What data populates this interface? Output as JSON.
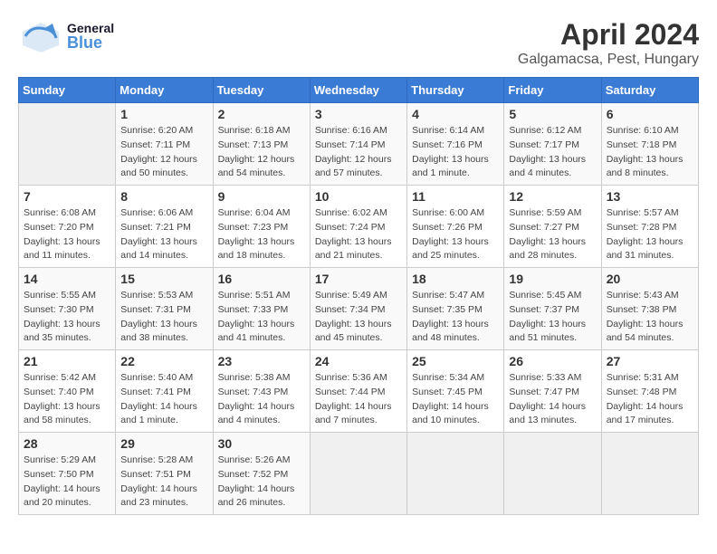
{
  "header": {
    "logo_general": "General",
    "logo_blue": "Blue",
    "title": "April 2024",
    "subtitle": "Galgamacsa, Pest, Hungary"
  },
  "calendar": {
    "days_of_week": [
      "Sunday",
      "Monday",
      "Tuesday",
      "Wednesday",
      "Thursday",
      "Friday",
      "Saturday"
    ],
    "weeks": [
      [
        {
          "day": "",
          "sunrise": "",
          "sunset": "",
          "daylight": "",
          "empty": true
        },
        {
          "day": "1",
          "sunrise": "6:20 AM",
          "sunset": "7:11 PM",
          "daylight": "12 hours and 50 minutes."
        },
        {
          "day": "2",
          "sunrise": "6:18 AM",
          "sunset": "7:13 PM",
          "daylight": "12 hours and 54 minutes."
        },
        {
          "day": "3",
          "sunrise": "6:16 AM",
          "sunset": "7:14 PM",
          "daylight": "12 hours and 57 minutes."
        },
        {
          "day": "4",
          "sunrise": "6:14 AM",
          "sunset": "7:16 PM",
          "daylight": "13 hours and 1 minute."
        },
        {
          "day": "5",
          "sunrise": "6:12 AM",
          "sunset": "7:17 PM",
          "daylight": "13 hours and 4 minutes."
        },
        {
          "day": "6",
          "sunrise": "6:10 AM",
          "sunset": "7:18 PM",
          "daylight": "13 hours and 8 minutes."
        }
      ],
      [
        {
          "day": "7",
          "sunrise": "6:08 AM",
          "sunset": "7:20 PM",
          "daylight": "13 hours and 11 minutes."
        },
        {
          "day": "8",
          "sunrise": "6:06 AM",
          "sunset": "7:21 PM",
          "daylight": "13 hours and 14 minutes."
        },
        {
          "day": "9",
          "sunrise": "6:04 AM",
          "sunset": "7:23 PM",
          "daylight": "13 hours and 18 minutes."
        },
        {
          "day": "10",
          "sunrise": "6:02 AM",
          "sunset": "7:24 PM",
          "daylight": "13 hours and 21 minutes."
        },
        {
          "day": "11",
          "sunrise": "6:00 AM",
          "sunset": "7:26 PM",
          "daylight": "13 hours and 25 minutes."
        },
        {
          "day": "12",
          "sunrise": "5:59 AM",
          "sunset": "7:27 PM",
          "daylight": "13 hours and 28 minutes."
        },
        {
          "day": "13",
          "sunrise": "5:57 AM",
          "sunset": "7:28 PM",
          "daylight": "13 hours and 31 minutes."
        }
      ],
      [
        {
          "day": "14",
          "sunrise": "5:55 AM",
          "sunset": "7:30 PM",
          "daylight": "13 hours and 35 minutes."
        },
        {
          "day": "15",
          "sunrise": "5:53 AM",
          "sunset": "7:31 PM",
          "daylight": "13 hours and 38 minutes."
        },
        {
          "day": "16",
          "sunrise": "5:51 AM",
          "sunset": "7:33 PM",
          "daylight": "13 hours and 41 minutes."
        },
        {
          "day": "17",
          "sunrise": "5:49 AM",
          "sunset": "7:34 PM",
          "daylight": "13 hours and 45 minutes."
        },
        {
          "day": "18",
          "sunrise": "5:47 AM",
          "sunset": "7:35 PM",
          "daylight": "13 hours and 48 minutes."
        },
        {
          "day": "19",
          "sunrise": "5:45 AM",
          "sunset": "7:37 PM",
          "daylight": "13 hours and 51 minutes."
        },
        {
          "day": "20",
          "sunrise": "5:43 AM",
          "sunset": "7:38 PM",
          "daylight": "13 hours and 54 minutes."
        }
      ],
      [
        {
          "day": "21",
          "sunrise": "5:42 AM",
          "sunset": "7:40 PM",
          "daylight": "13 hours and 58 minutes."
        },
        {
          "day": "22",
          "sunrise": "5:40 AM",
          "sunset": "7:41 PM",
          "daylight": "14 hours and 1 minute."
        },
        {
          "day": "23",
          "sunrise": "5:38 AM",
          "sunset": "7:43 PM",
          "daylight": "14 hours and 4 minutes."
        },
        {
          "day": "24",
          "sunrise": "5:36 AM",
          "sunset": "7:44 PM",
          "daylight": "14 hours and 7 minutes."
        },
        {
          "day": "25",
          "sunrise": "5:34 AM",
          "sunset": "7:45 PM",
          "daylight": "14 hours and 10 minutes."
        },
        {
          "day": "26",
          "sunrise": "5:33 AM",
          "sunset": "7:47 PM",
          "daylight": "14 hours and 13 minutes."
        },
        {
          "day": "27",
          "sunrise": "5:31 AM",
          "sunset": "7:48 PM",
          "daylight": "14 hours and 17 minutes."
        }
      ],
      [
        {
          "day": "28",
          "sunrise": "5:29 AM",
          "sunset": "7:50 PM",
          "daylight": "14 hours and 20 minutes."
        },
        {
          "day": "29",
          "sunrise": "5:28 AM",
          "sunset": "7:51 PM",
          "daylight": "14 hours and 23 minutes."
        },
        {
          "day": "30",
          "sunrise": "5:26 AM",
          "sunset": "7:52 PM",
          "daylight": "14 hours and 26 minutes."
        },
        {
          "day": "",
          "sunrise": "",
          "sunset": "",
          "daylight": "",
          "empty": true
        },
        {
          "day": "",
          "sunrise": "",
          "sunset": "",
          "daylight": "",
          "empty": true
        },
        {
          "day": "",
          "sunrise": "",
          "sunset": "",
          "daylight": "",
          "empty": true
        },
        {
          "day": "",
          "sunrise": "",
          "sunset": "",
          "daylight": "",
          "empty": true
        }
      ]
    ]
  }
}
